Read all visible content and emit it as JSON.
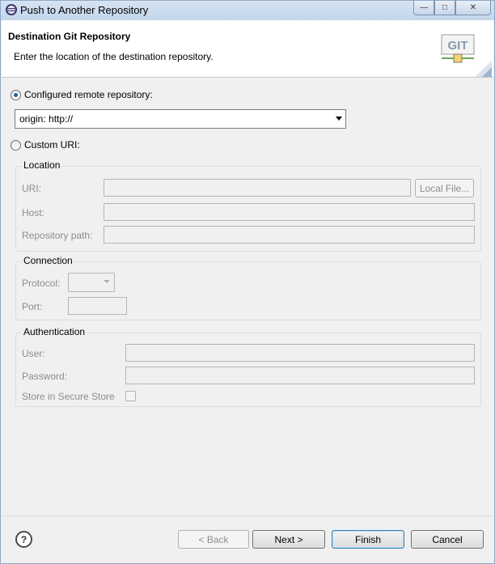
{
  "window": {
    "title": "Push to Another Repository",
    "controls": {
      "minimize": "—",
      "maximize": "□",
      "close": "✕"
    }
  },
  "header": {
    "title": "Destination Git Repository",
    "description": "Enter the location of the destination repository.",
    "logo_text": "GIT"
  },
  "configured": {
    "radio_label": "Configured remote repository:",
    "selected": true,
    "combo_value": "origin: http://"
  },
  "custom": {
    "radio_label": "Custom URI:",
    "selected": false
  },
  "location": {
    "group_title": "Location",
    "uri_label": "URI:",
    "uri_value": "",
    "local_file_button": "Local File...",
    "host_label": "Host:",
    "host_value": "",
    "path_label": "Repository path:",
    "path_value": ""
  },
  "connection": {
    "group_title": "Connection",
    "protocol_label": "Protocol:",
    "protocol_value": "",
    "port_label": "Port:",
    "port_value": ""
  },
  "authentication": {
    "group_title": "Authentication",
    "user_label": "User:",
    "user_value": "",
    "password_label": "Password:",
    "password_value": "",
    "secure_store_label": "Store in Secure Store",
    "secure_store_checked": false
  },
  "footer": {
    "help": "?",
    "back_button": "< Back",
    "next_button": "Next >",
    "finish_button": "Finish",
    "cancel_button": "Cancel"
  }
}
